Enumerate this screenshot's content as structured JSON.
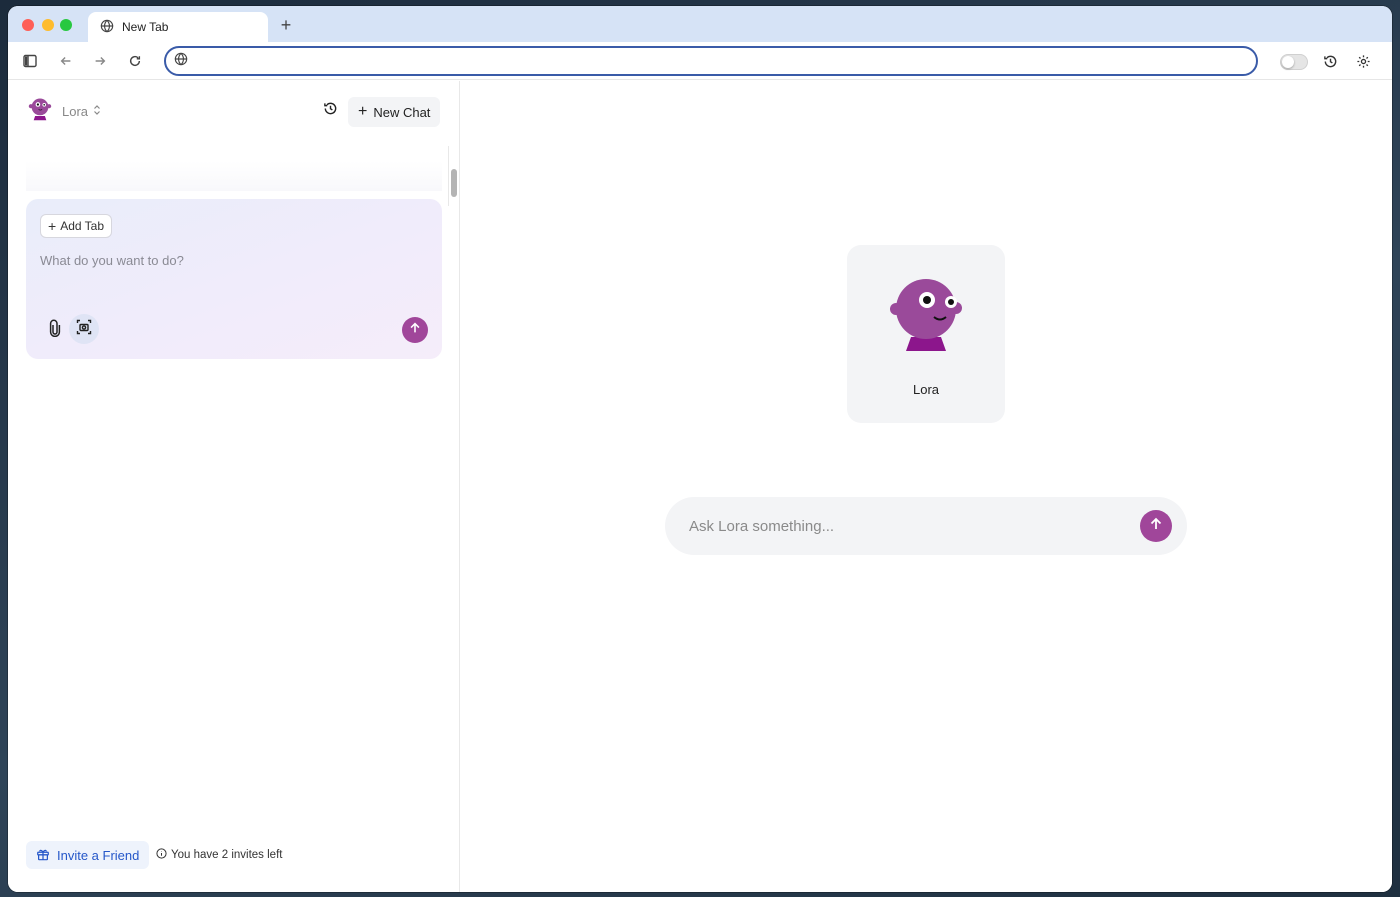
{
  "browser": {
    "tab": {
      "title": "New Tab",
      "icon": "globe-icon"
    },
    "new_tab_label": "+",
    "address": {
      "value": "",
      "placeholder": ""
    },
    "toolbar_icons": [
      "sidebar-toggle-icon",
      "back-arrow-icon",
      "forward-arrow-icon",
      "reload-icon",
      "history-icon",
      "gear-icon"
    ]
  },
  "sidebar": {
    "agent": {
      "name": "Lora",
      "chevron": "⌃⌄"
    },
    "new_chat_label": "New Chat",
    "composer": {
      "add_tab_label": "Add Tab",
      "placeholder": "What do you want to do?",
      "value": ""
    },
    "invite": {
      "button_label": "Invite a Friend",
      "status_text": "You have 2 invites left"
    }
  },
  "main": {
    "agent_card_name": "Lora",
    "ask": {
      "placeholder": "Ask Lora something...",
      "value": ""
    }
  },
  "colors": {
    "accent": "#a0469a",
    "avatar": "#9a4a9a",
    "avatar_shirt": "#8c168c",
    "link": "#2557c9",
    "omnibox_border": "#3a5ba8"
  }
}
